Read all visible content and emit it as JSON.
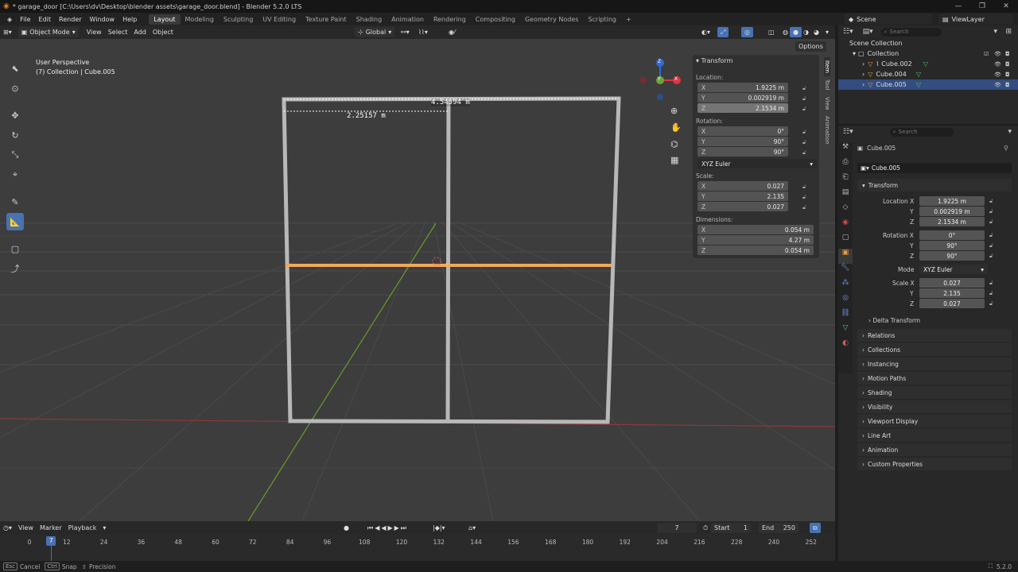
{
  "window": {
    "title": "* garage_door [C:\\Users\\dv\\Desktop\\blender assets\\garage_door.blend] - Blender 5.2.0 LTS",
    "controls": [
      "—",
      "❐",
      "✕"
    ]
  },
  "menubar": {
    "items": [
      "File",
      "Edit",
      "Render",
      "Window",
      "Help"
    ],
    "workspaces": [
      "Layout",
      "Modeling",
      "Sculpting",
      "UV Editing",
      "Texture Paint",
      "Shading",
      "Animation",
      "Rendering",
      "Compositing",
      "Geometry Nodes",
      "Scripting"
    ],
    "active_workspace": "Layout",
    "add_workspace": "+",
    "scene": "Scene",
    "view_layer": "ViewLayer"
  },
  "viewport_header": {
    "mode": "Object Mode",
    "menus": [
      "View",
      "Select",
      "Add",
      "Object"
    ],
    "orientation": "Global",
    "options": "Options"
  },
  "viewport": {
    "overlay_line1": "User Perspective",
    "overlay_line2": "(7) Collection | Cube.005",
    "measure1": "4.54594 m",
    "measure2": "2.25157 m",
    "gizmo": {
      "x": "X",
      "y": "Y",
      "z": "Z"
    }
  },
  "sidebar_tabs": [
    "Item",
    "Tool",
    "View",
    "Animation"
  ],
  "npanel": {
    "title": "Transform",
    "location_label": "Location:",
    "location": [
      {
        "axis": "X",
        "value": "1.9225 m"
      },
      {
        "axis": "Y",
        "value": "0.002919 m"
      },
      {
        "axis": "Z",
        "value": "2.1534 m"
      }
    ],
    "rotation_label": "Rotation:",
    "rotation": [
      {
        "axis": "X",
        "value": "0°"
      },
      {
        "axis": "Y",
        "value": "90°"
      },
      {
        "axis": "Z",
        "value": "90°"
      }
    ],
    "rotation_mode": "XYZ Euler",
    "scale_label": "Scale:",
    "scale": [
      {
        "axis": "X",
        "value": "0.027"
      },
      {
        "axis": "Y",
        "value": "2.135"
      },
      {
        "axis": "Z",
        "value": "0.027"
      }
    ],
    "dimensions_label": "Dimensions:",
    "dimensions": [
      {
        "axis": "X",
        "value": "0.054 m"
      },
      {
        "axis": "Y",
        "value": "4.27 m"
      },
      {
        "axis": "Z",
        "value": "0.054 m"
      }
    ]
  },
  "outliner": {
    "search_placeholder": "Search",
    "root": "Scene Collection",
    "collection": "Collection",
    "items": [
      "Cube.002",
      "Cube.004",
      "Cube.005"
    ],
    "selected": "Cube.005"
  },
  "properties": {
    "search_placeholder": "Search",
    "object_name": "Cube.005",
    "object_field": "Cube.005",
    "transform_title": "Transform",
    "location_label": "Location X",
    "location": [
      "1.9225 m",
      "0.002919 m",
      "2.1534 m"
    ],
    "rotation_label": "Rotation X",
    "rotation": [
      "0°",
      "90°",
      "90°"
    ],
    "mode_label": "Mode",
    "mode": "XYZ Euler",
    "scale_label": "Scale X",
    "scale": [
      "0.027",
      "2.135",
      "0.027"
    ],
    "axis_y": "Y",
    "axis_z": "Z",
    "delta": "Delta Transform",
    "panels": [
      "Relations",
      "Collections",
      "Instancing",
      "Motion Paths",
      "Shading",
      "Visibility",
      "Viewport Display",
      "Line Art",
      "Animation",
      "Custom Properties"
    ]
  },
  "timeline": {
    "menus": [
      "View",
      "Marker",
      "Playback"
    ],
    "current_frame": "7",
    "start_label": "Start",
    "start": "1",
    "end_label": "End",
    "end": "250",
    "ticks": [
      "0",
      "12",
      "24",
      "36",
      "48",
      "60",
      "72",
      "84",
      "96",
      "108",
      "120",
      "132",
      "144",
      "156",
      "168",
      "180",
      "192",
      "204",
      "216",
      "228",
      "240",
      "252"
    ],
    "playhead": "7"
  },
  "statusbar": {
    "cancel_key": "Esc",
    "cancel": "Cancel",
    "snap_key": "Ctrl",
    "snap": "Snap",
    "precision": "Precision",
    "version": "5.2.0"
  }
}
